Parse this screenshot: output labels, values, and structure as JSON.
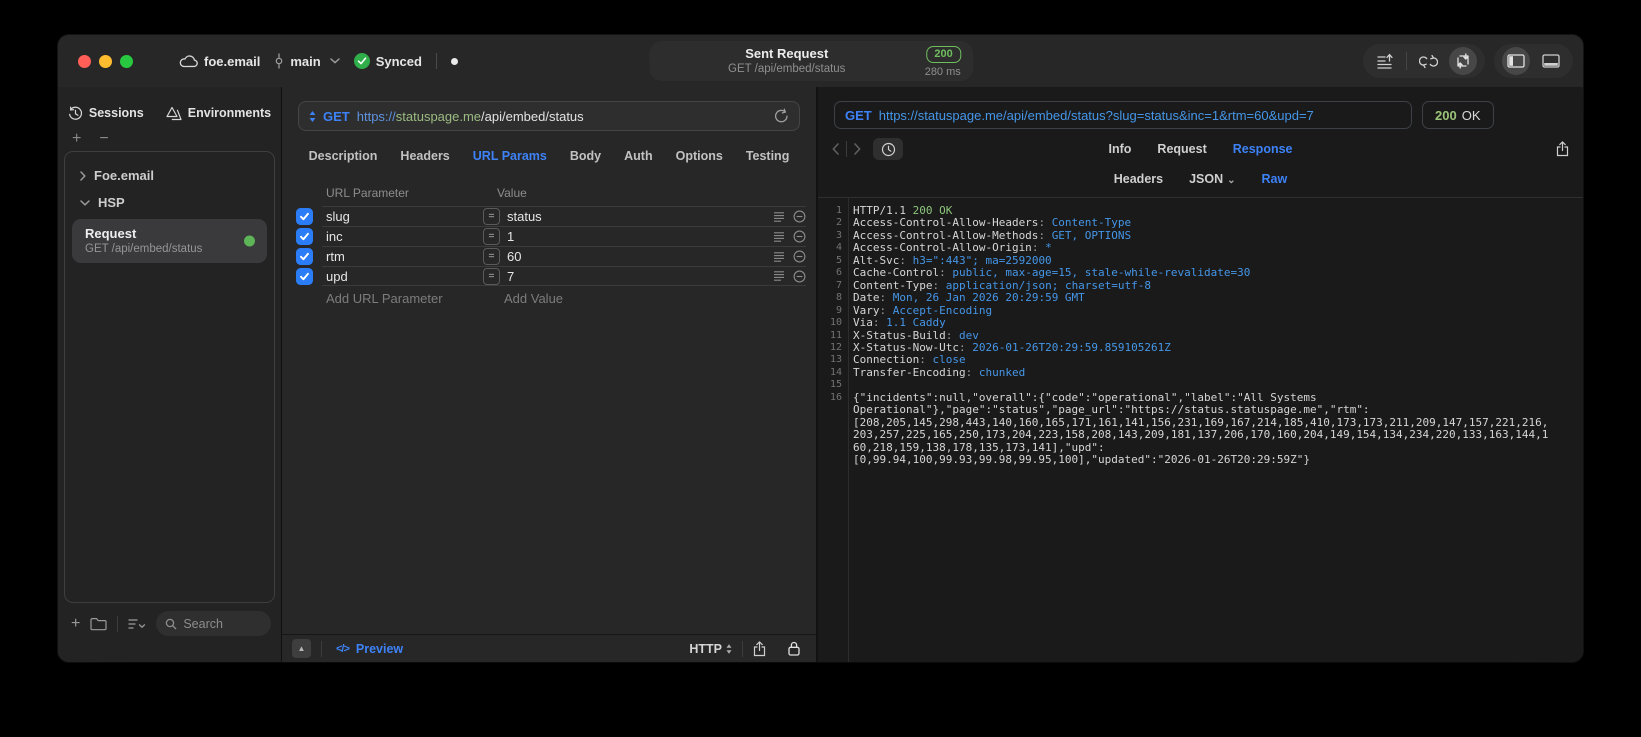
{
  "colors": {
    "accent": "#3d82f7",
    "checkbox-blue": "#2a7cf7",
    "green-badge": "#6fbe5e",
    "code-green": "#8bc57a",
    "code-blue": "#4596e8",
    "url-scheme-blue": "#5e93e0",
    "url-host-green": "#9cbc82",
    "traffic-red": "#ff5f57",
    "traffic-yellow": "#febc2e",
    "traffic-green": "#28c840"
  },
  "icons": {
    "preview-code-icon": "</>",
    "panel-collapse-icon": "▲",
    "equals-icon": "=",
    "json-chevron-icon": "⌄"
  },
  "titlebar": {
    "project": "foe.email",
    "branch": "main",
    "sync_status": "Synced",
    "request_title": "Sent Request",
    "request_subtitle": "GET /api/embed/status",
    "status_code": "200",
    "duration": "280 ms"
  },
  "sidebar": {
    "tabs": [
      {
        "label": "Sessions"
      },
      {
        "label": "Environments"
      }
    ],
    "tree": {
      "group1": {
        "label": "Foe.email",
        "state": "collapsed"
      },
      "group2": {
        "label": "HSP",
        "state": "expanded"
      },
      "request": {
        "label": "Request",
        "subtitle": "GET /api/embed/status",
        "selected": true,
        "status_dot": "green"
      }
    },
    "search_placeholder": "Search"
  },
  "request_panel": {
    "method": "GET",
    "url_scheme": "https://",
    "url_host": "statuspage.me",
    "url_path": "/api/embed/status",
    "tabs": [
      {
        "label": "Description"
      },
      {
        "label": "Headers"
      },
      {
        "label": "URL Params",
        "active": true
      },
      {
        "label": "Body"
      },
      {
        "label": "Auth"
      },
      {
        "label": "Options"
      },
      {
        "label": "Testing"
      }
    ],
    "params": {
      "col_name": "URL Parameter",
      "col_value": "Value",
      "rows": [
        {
          "enabled": true,
          "name": "slug",
          "value": "status"
        },
        {
          "enabled": true,
          "name": "inc",
          "value": "1"
        },
        {
          "enabled": true,
          "name": "rtm",
          "value": "60"
        },
        {
          "enabled": true,
          "name": "upd",
          "value": "7"
        }
      ],
      "add_name_placeholder": "Add URL Parameter",
      "add_value_placeholder": "Add Value"
    },
    "footer": {
      "preview_label": "Preview",
      "protocol": "HTTP"
    }
  },
  "response_panel": {
    "method": "GET",
    "url": "https://statuspage.me/api/embed/status?slug=status&inc=1&rtm=60&upd=7",
    "status": {
      "code": "200",
      "text": "OK"
    },
    "tabs": [
      {
        "label": "Info"
      },
      {
        "label": "Request"
      },
      {
        "label": "Response",
        "active": true
      }
    ],
    "subtabs": [
      {
        "label": "Headers"
      },
      {
        "label": "JSON",
        "chevron": true
      },
      {
        "label": "Raw",
        "active": true
      }
    ],
    "status_line": {
      "protocol": "HTTP/1.1",
      "status": "200 OK"
    },
    "headers": [
      {
        "name": "Access-Control-Allow-Headers",
        "value": "Content-Type"
      },
      {
        "name": "Access-Control-Allow-Methods",
        "value": "GET, OPTIONS"
      },
      {
        "name": "Access-Control-Allow-Origin",
        "value": "*"
      },
      {
        "name": "Alt-Svc",
        "value": "h3=\":443\"; ma=2592000"
      },
      {
        "name": "Cache-Control",
        "value": "public, max-age=15, stale-while-revalidate=30"
      },
      {
        "name": "Content-Type",
        "value": "application/json; charset=utf-8"
      },
      {
        "name": "Date",
        "value": "Mon, 26 Jan 2026 20:29:59 GMT"
      },
      {
        "name": "Vary",
        "value": "Accept-Encoding"
      },
      {
        "name": "Via",
        "value": "1.1 Caddy"
      },
      {
        "name": "X-Status-Build",
        "value": "dev"
      },
      {
        "name": "X-Status-Now-Utc",
        "value": "2026-01-26T20:29:59.859105261Z"
      },
      {
        "name": "Connection",
        "value": "close"
      },
      {
        "name": "Transfer-Encoding",
        "value": "chunked"
      }
    ],
    "body_lines": [
      "{\"incidents\":null,\"overall\":{\"code\":\"operational\",\"label\":\"All Systems",
      "Operational\"},\"page\":\"status\",\"page_url\":\"https://status.statuspage.me\",\"rtm\":",
      "[208,205,145,298,443,140,160,165,171,161,141,156,231,169,167,214,185,410,173,173,211,209,147,157,221,216,",
      "203,257,225,165,250,173,204,223,158,208,143,209,181,137,206,170,160,204,149,154,134,234,220,133,163,144,1",
      "60,218,159,138,178,135,173,141],\"upd\":",
      "[0,99.94,100,99.93,99.98,99.95,100],\"updated\":\"2026-01-26T20:29:59Z\"}"
    ]
  }
}
